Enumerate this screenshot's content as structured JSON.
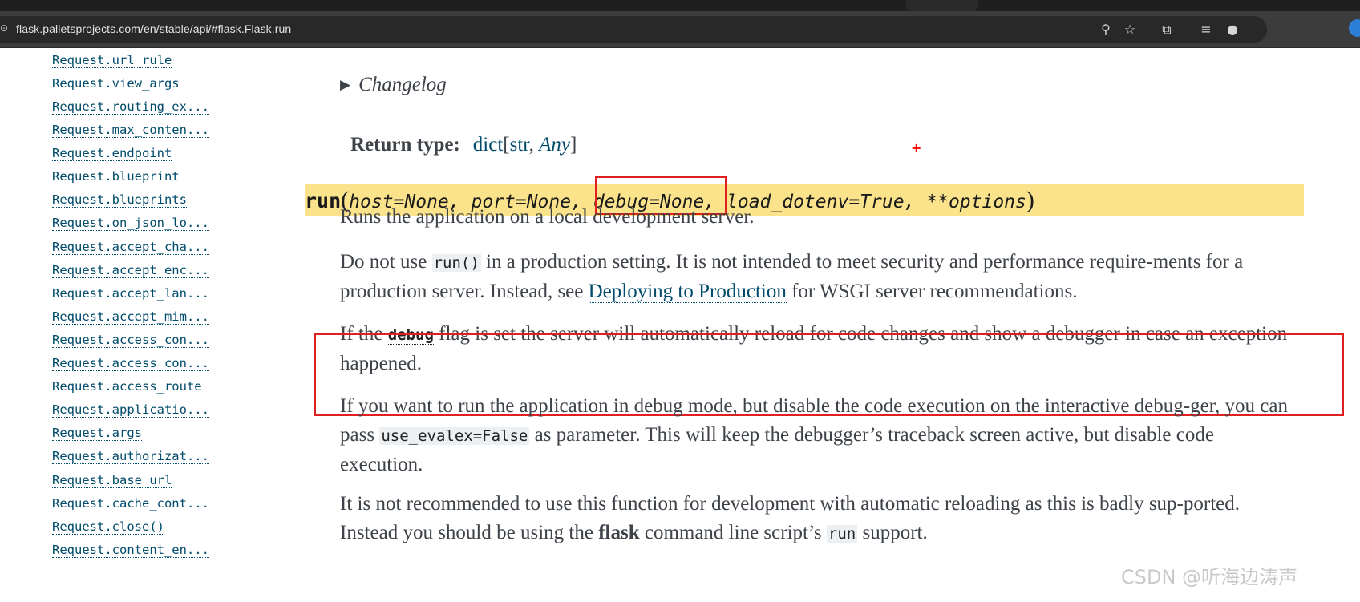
{
  "browser": {
    "url": "flask.palletsprojects.com/en/stable/api/#flask.Flask.run"
  },
  "sidebar": {
    "items": [
      "Request.url_rule",
      "Request.view_args",
      "Request.routing_ex...",
      "Request.max_conten...",
      "Request.endpoint",
      "Request.blueprint",
      "Request.blueprints",
      "Request.on_json_lo...",
      "Request.accept_cha...",
      "Request.accept_enc...",
      "Request.accept_lan...",
      "Request.accept_mim...",
      "Request.access_con...",
      "Request.access_con...",
      "Request.access_route",
      "Request.applicatio...",
      "Request.args",
      "Request.authorizat...",
      "Request.base_url",
      "Request.cache_cont...",
      "Request.close()",
      "Request.content_en..."
    ]
  },
  "main": {
    "changelog": "Changelog",
    "return_type_label": "Return type:",
    "return_type": {
      "dict": "dict",
      "open": "[",
      "str": "str",
      "sep": ", ",
      "any": "Any",
      "close": "]"
    },
    "plus_marker": "+",
    "signature": {
      "name": "run",
      "open": "(",
      "params_before": "host=None, port=None,",
      "params_highlighted": "debug=None,",
      "params_after": "load_dotenv=True, **options",
      "close": ")"
    },
    "p1": "Runs the application on a local development server.",
    "p2": {
      "before": "Do not use ",
      "code": "run()",
      "middle": " in a production setting. It is not intended to meet security and performance require-ments for a production server. Instead, see ",
      "link": "Deploying to Production",
      "after": " for WSGI server recommendations."
    },
    "p3": {
      "before": "If the ",
      "code": "debug",
      "after": " flag is set the server will automatically reload for code changes and show a debugger in case an exception happened."
    },
    "p4": {
      "before": "If you want to run the application in debug mode, but disable the code execution on the interactive debug-ger, you can pass ",
      "code": "use_evalex=False",
      "after": " as parameter. This will keep the debugger’s traceback screen active, but disable code execution."
    },
    "p5": {
      "before": "It is not recommended to use this function for development with automatic reloading as this is badly sup-ported. Instead you should be using the ",
      "bold": "flask",
      "middle": " command line script’s ",
      "code": "run",
      "after": " support."
    }
  },
  "watermark": "CSDN @听海边涛声"
}
